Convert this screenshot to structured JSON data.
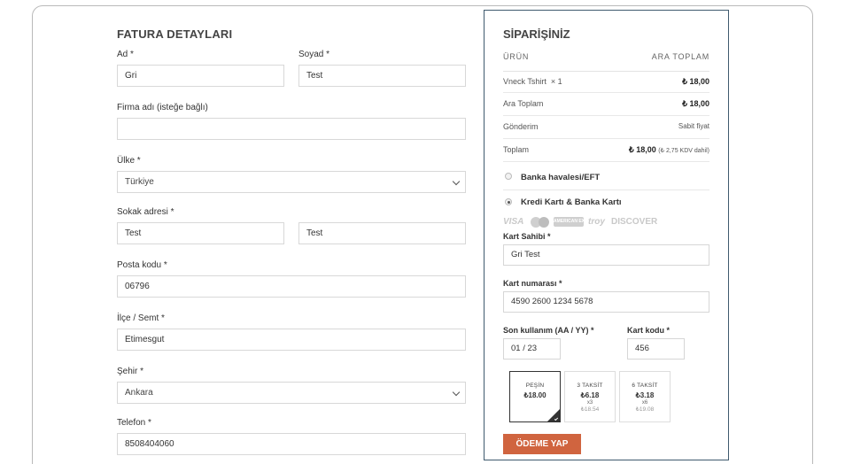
{
  "billing": {
    "title": "FATURA DETAYLARI",
    "first_name_label": "Ad *",
    "first_name_value": "Gri",
    "last_name_label": "Soyad *",
    "last_name_value": "Test",
    "company_label": "Firma adı (isteğe bağlı)",
    "company_value": "",
    "country_label": "Ülke *",
    "country_value": "Türkiye",
    "street_label": "Sokak adresi *",
    "street_value_1": "Test",
    "street_value_2": "Test",
    "postcode_label": "Posta kodu *",
    "postcode_value": "06796",
    "district_label": "İlçe / Semt *",
    "district_value": "Etimesgut",
    "city_label": "Şehir *",
    "city_value": "Ankara",
    "phone_label": "Telefon *",
    "phone_value": "8508404060"
  },
  "order": {
    "title": "SİPARİŞİNİZ",
    "col_product": "ÜRÜN",
    "col_subtotal": "ARA TOPLAM",
    "item_name": "Vneck Tshirt",
    "item_qty": "× 1",
    "item_price": "₺ 18,00",
    "subtotal_label": "Ara Toplam",
    "subtotal_value": "₺ 18,00",
    "shipping_label": "Gönderim",
    "shipping_value": "Sabit fiyat",
    "total_label": "Toplam",
    "total_value": "₺ 18,00",
    "total_tax_note": "(₺ 2,75 KDV dahil)"
  },
  "payment": {
    "method_bank": "Banka havalesi/EFT",
    "method_card": "Kredi Kartı & Banka Kartı",
    "brand_visa": "VISA",
    "brand_amex": "AMERICAN EXPRESS",
    "brand_troy": "troy",
    "brand_discover": "DISCOVER",
    "card_holder_label": "Kart Sahibi *",
    "card_holder_value": "Gri Test",
    "card_number_label": "Kart numarası *",
    "card_number_value": "4590 2600 1234 5678",
    "expiry_label": "Son kullanım (AA / YY) *",
    "expiry_value": "01 / 23",
    "cvc_label": "Kart kodu *",
    "cvc_value": "456",
    "installments": [
      {
        "title": "PEŞİN",
        "amount": "₺18.00",
        "times": "",
        "total": ""
      },
      {
        "title": "3 TAKSİT",
        "amount": "₺6.18",
        "times": "x3",
        "total": "₺18.54"
      },
      {
        "title": "6 TAKSİT",
        "amount": "₺3.18",
        "times": "x6",
        "total": "₺19.08"
      }
    ],
    "pay_button": "ÖDEME YAP"
  },
  "colors": {
    "accent": "#d0643f",
    "order_border": "#3f5a6e"
  }
}
